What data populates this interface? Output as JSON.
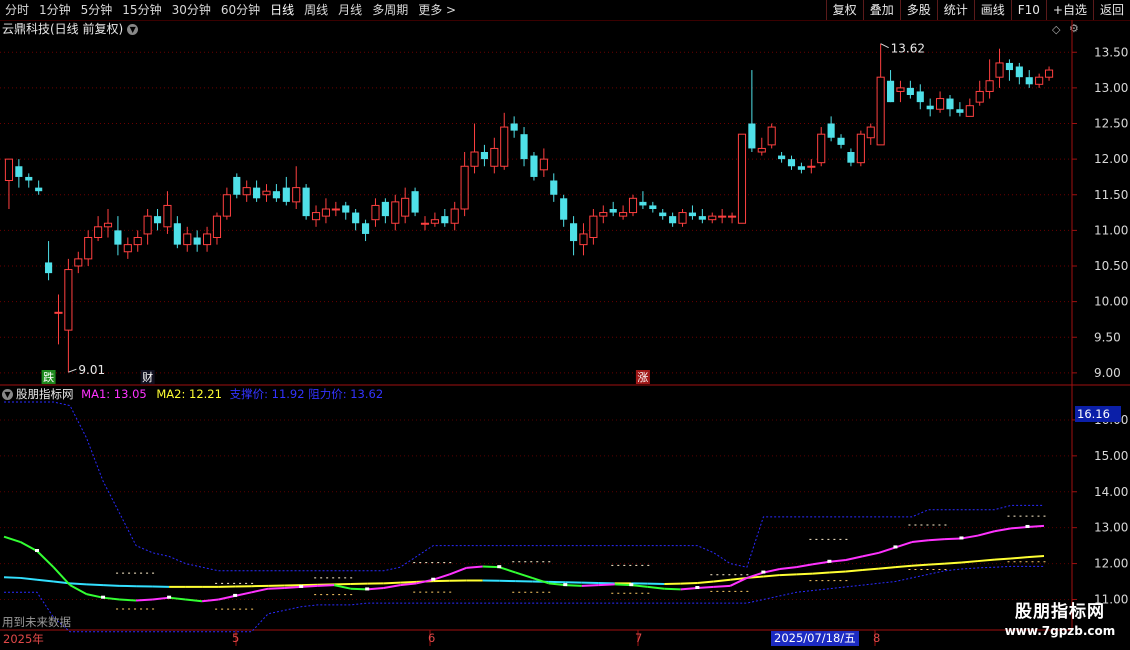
{
  "toolbar": {
    "timeframes": [
      "分时",
      "1分钟",
      "5分钟",
      "15分钟",
      "30分钟",
      "60分钟",
      "日线",
      "周线",
      "月线",
      "多周期",
      "更多 >"
    ],
    "active_index": 6,
    "tools": [
      "复权",
      "叠加",
      "多股",
      "统计",
      "画线",
      "F10",
      "+自选",
      "返回"
    ]
  },
  "stock_title": "云鼎科技(日线 前复权)",
  "price_axis": [
    "13.50",
    "13.00",
    "12.50",
    "12.00",
    "11.50",
    "11.00",
    "10.50",
    "10.00",
    "9.50",
    "9.00"
  ],
  "annotations": {
    "high": "13.62",
    "low": "9.01"
  },
  "markers": [
    {
      "text": "跌",
      "bg": "#1f8a1f",
      "fg": "#ffffff"
    },
    {
      "text": "财",
      "bg": "#101020",
      "fg": "#ffffff"
    },
    {
      "text": "涨",
      "bg": "#a01818",
      "fg": "#ffffff"
    }
  ],
  "indicator": {
    "name": "股朋指标网",
    "ma1_label": "MA1: 13.05",
    "ma2_label": "MA2: 12.21",
    "support_label": "支撑价: 11.92",
    "resistance_label": "阻力价: 13.62",
    "colors": {
      "ma1": "#ff33ff",
      "ma2": "#ffff33",
      "support": "#3333ff",
      "resistance": "#3333ff",
      "name": "#e8e8e8"
    },
    "axis": [
      "16.16",
      "16.00",
      "15.00",
      "14.00",
      "13.00",
      "12.00",
      "11.00"
    ],
    "current": "16.16"
  },
  "future_label": "用到未来数据",
  "x_labels": [
    "2025年",
    "5",
    "6",
    "7",
    "8"
  ],
  "date_box": "2025/07/18/五",
  "watermark": {
    "line1": "股朋指标网",
    "line2": "www.7gpzb.com"
  },
  "colors": {
    "up": "#ff4040",
    "down": "#4fe0e8",
    "grid": "#7a0000",
    "axis_text": "#d04040",
    "bg": "#000000"
  },
  "chart_data": [
    {
      "type": "candlestick",
      "title": "云鼎科技(日线 前复权)",
      "ylim": [
        8.9,
        13.7
      ],
      "candles": [
        [
          11.7,
          12.0,
          12.0,
          11.3
        ],
        [
          11.9,
          11.75,
          12.0,
          11.6
        ],
        [
          11.75,
          11.7,
          11.8,
          11.6
        ],
        [
          11.6,
          11.55,
          11.7,
          11.5
        ],
        [
          10.55,
          10.4,
          10.85,
          10.3
        ],
        [
          9.85,
          9.85,
          10.1,
          9.4
        ],
        [
          9.6,
          10.45,
          10.6,
          9.01
        ],
        [
          10.5,
          10.6,
          10.7,
          10.4
        ],
        [
          10.6,
          10.9,
          11.0,
          10.5
        ],
        [
          10.9,
          11.05,
          11.2,
          10.85
        ],
        [
          11.05,
          11.1,
          11.3,
          10.9
        ],
        [
          11.0,
          10.8,
          11.2,
          10.65
        ],
        [
          10.7,
          10.8,
          10.9,
          10.6
        ],
        [
          10.8,
          10.9,
          11.0,
          10.7
        ],
        [
          10.95,
          11.2,
          11.3,
          10.8
        ],
        [
          11.2,
          11.1,
          11.3,
          11.0
        ],
        [
          11.05,
          11.35,
          11.55,
          10.95
        ],
        [
          11.1,
          10.8,
          11.2,
          10.75
        ],
        [
          10.8,
          10.95,
          11.05,
          10.7
        ],
        [
          10.9,
          10.8,
          11.0,
          10.7
        ],
        [
          10.8,
          10.95,
          11.05,
          10.7
        ],
        [
          10.9,
          11.2,
          11.25,
          10.8
        ],
        [
          11.2,
          11.5,
          11.6,
          11.15
        ],
        [
          11.75,
          11.5,
          11.8,
          11.45
        ],
        [
          11.5,
          11.6,
          11.7,
          11.4
        ],
        [
          11.6,
          11.45,
          11.7,
          11.4
        ],
        [
          11.5,
          11.55,
          11.65,
          11.4
        ],
        [
          11.55,
          11.45,
          11.65,
          11.4
        ],
        [
          11.6,
          11.4,
          11.75,
          11.35
        ],
        [
          11.4,
          11.6,
          11.9,
          11.3
        ],
        [
          11.6,
          11.2,
          11.65,
          11.15
        ],
        [
          11.15,
          11.25,
          11.35,
          11.05
        ],
        [
          11.2,
          11.3,
          11.45,
          11.1
        ],
        [
          11.3,
          11.3,
          11.4,
          11.2
        ],
        [
          11.35,
          11.25,
          11.4,
          11.15
        ],
        [
          11.25,
          11.1,
          11.3,
          11.0
        ],
        [
          11.1,
          10.95,
          11.15,
          10.85
        ],
        [
          11.15,
          11.35,
          11.45,
          11.05
        ],
        [
          11.4,
          11.2,
          11.45,
          11.1
        ],
        [
          11.1,
          11.4,
          11.5,
          11.0
        ],
        [
          11.2,
          11.45,
          11.6,
          11.1
        ],
        [
          11.55,
          11.25,
          11.6,
          11.2
        ],
        [
          11.1,
          11.1,
          11.2,
          11.0
        ],
        [
          11.1,
          11.15,
          11.25,
          11.05
        ],
        [
          11.2,
          11.1,
          11.3,
          11.05
        ],
        [
          11.1,
          11.3,
          11.4,
          11.0
        ],
        [
          11.3,
          11.9,
          12.1,
          11.2
        ],
        [
          11.9,
          12.1,
          12.5,
          11.8
        ],
        [
          12.1,
          12.0,
          12.2,
          11.9
        ],
        [
          11.9,
          12.15,
          12.3,
          11.8
        ],
        [
          11.9,
          12.45,
          12.65,
          11.85
        ],
        [
          12.5,
          12.4,
          12.6,
          12.3
        ],
        [
          12.35,
          12.0,
          12.45,
          11.9
        ],
        [
          12.05,
          11.75,
          12.1,
          11.7
        ],
        [
          11.85,
          12.0,
          12.15,
          11.75
        ],
        [
          11.7,
          11.5,
          11.8,
          11.4
        ],
        [
          11.45,
          11.15,
          11.5,
          11.05
        ],
        [
          11.1,
          10.85,
          11.2,
          10.65
        ],
        [
          10.8,
          10.95,
          11.1,
          10.65
        ],
        [
          10.9,
          11.2,
          11.3,
          10.8
        ],
        [
          11.2,
          11.25,
          11.35,
          11.1
        ],
        [
          11.3,
          11.25,
          11.4,
          11.2
        ],
        [
          11.2,
          11.25,
          11.35,
          11.15
        ],
        [
          11.25,
          11.45,
          11.5,
          11.2
        ],
        [
          11.4,
          11.35,
          11.55,
          11.3
        ],
        [
          11.35,
          11.3,
          11.4,
          11.25
        ],
        [
          11.25,
          11.2,
          11.3,
          11.15
        ],
        [
          11.2,
          11.1,
          11.25,
          11.05
        ],
        [
          11.1,
          11.25,
          11.3,
          11.05
        ],
        [
          11.25,
          11.2,
          11.35,
          11.15
        ],
        [
          11.2,
          11.15,
          11.3,
          11.1
        ],
        [
          11.15,
          11.2,
          11.25,
          11.1
        ],
        [
          11.2,
          11.2,
          11.3,
          11.1
        ],
        [
          11.2,
          11.2,
          11.25,
          11.1
        ],
        [
          11.1,
          12.35,
          12.35,
          11.1
        ],
        [
          12.5,
          12.15,
          13.25,
          12.1
        ],
        [
          12.1,
          12.15,
          12.3,
          12.05
        ],
        [
          12.2,
          12.45,
          12.5,
          12.15
        ],
        [
          12.05,
          12.0,
          12.1,
          11.95
        ],
        [
          12.0,
          11.9,
          12.05,
          11.85
        ],
        [
          11.9,
          11.85,
          11.95,
          11.8
        ],
        [
          11.9,
          11.9,
          12.0,
          11.8
        ],
        [
          11.95,
          12.35,
          12.45,
          11.9
        ],
        [
          12.5,
          12.3,
          12.6,
          12.25
        ],
        [
          12.3,
          12.2,
          12.35,
          12.15
        ],
        [
          12.1,
          11.95,
          12.15,
          11.9
        ],
        [
          11.95,
          12.35,
          12.4,
          11.9
        ],
        [
          12.3,
          12.45,
          12.5,
          12.2
        ],
        [
          12.2,
          13.15,
          13.62,
          12.2
        ],
        [
          13.1,
          12.8,
          13.25,
          12.8
        ],
        [
          12.95,
          13.0,
          13.1,
          12.8
        ],
        [
          13.0,
          12.9,
          13.1,
          12.85
        ],
        [
          12.95,
          12.8,
          13.05,
          12.7
        ],
        [
          12.75,
          12.7,
          12.85,
          12.6
        ],
        [
          12.7,
          12.85,
          12.95,
          12.65
        ],
        [
          12.85,
          12.7,
          12.9,
          12.6
        ],
        [
          12.7,
          12.65,
          12.8,
          12.6
        ],
        [
          12.6,
          12.75,
          12.85,
          12.6
        ],
        [
          12.8,
          12.95,
          13.1,
          12.75
        ],
        [
          12.95,
          13.1,
          13.4,
          12.85
        ],
        [
          13.15,
          13.35,
          13.55,
          13.0
        ],
        [
          13.35,
          13.25,
          13.4,
          13.1
        ],
        [
          13.3,
          13.15,
          13.35,
          13.05
        ],
        [
          13.15,
          13.05,
          13.25,
          13.0
        ],
        [
          13.05,
          13.15,
          13.2,
          13.0
        ],
        [
          13.15,
          13.25,
          13.3,
          13.1
        ]
      ]
    },
    {
      "type": "line",
      "title": "股朋指标网",
      "ylim": [
        10.15,
        16.5
      ],
      "series": [
        {
          "name": "MA1",
          "values": [
            12.75,
            12.6,
            12.35,
            11.9,
            11.4,
            11.15,
            11.05,
            11.0,
            10.97,
            11.0,
            11.05,
            11.0,
            10.95,
            11.0,
            11.1,
            11.2,
            11.3,
            11.32,
            11.35,
            11.38,
            11.4,
            11.3,
            11.28,
            11.32,
            11.4,
            11.45,
            11.55,
            11.7,
            11.88,
            11.92,
            11.9,
            11.75,
            11.6,
            11.45,
            11.4,
            11.38,
            11.4,
            11.42,
            11.4,
            11.35,
            11.3,
            11.28,
            11.32,
            11.35,
            11.38,
            11.6,
            11.75,
            11.85,
            11.9,
            11.98,
            12.05,
            12.1,
            12.2,
            12.3,
            12.45,
            12.6,
            12.65,
            12.68,
            12.7,
            12.78,
            12.9,
            12.98,
            13.02,
            13.05
          ]
        },
        {
          "name": "MA2",
          "values": [
            11.62,
            11.6,
            11.55,
            11.5,
            11.45,
            11.42,
            11.4,
            11.38,
            11.37,
            11.36,
            11.35,
            11.35,
            11.35,
            11.35,
            11.36,
            11.37,
            11.38,
            11.39,
            11.4,
            11.41,
            11.42,
            11.43,
            11.44,
            11.45,
            11.47,
            11.49,
            11.51,
            11.52,
            11.53,
            11.53,
            11.52,
            11.51,
            11.5,
            11.49,
            11.48,
            11.47,
            11.46,
            11.45,
            11.45,
            11.44,
            11.43,
            11.44,
            11.46,
            11.5,
            11.55,
            11.6,
            11.64,
            11.68,
            11.7,
            11.72,
            11.75,
            11.78,
            11.82,
            11.86,
            11.9,
            11.94,
            11.97,
            12.0,
            12.03,
            12.07,
            12.11,
            12.14,
            12.18,
            12.21
          ]
        }
      ],
      "support": [
        11.2,
        11.2,
        11.2,
        10.5,
        10.1,
        10.1,
        10.1,
        10.1,
        10.1,
        10.1,
        10.1,
        10.1,
        10.1,
        10.1,
        10.1,
        10.1,
        10.6,
        10.7,
        10.8,
        10.85,
        10.85,
        10.85,
        10.9,
        10.9,
        10.9,
        10.9,
        10.9,
        10.9,
        10.9,
        10.9,
        10.9,
        10.9,
        10.9,
        10.9,
        10.9,
        10.9,
        10.9,
        10.9,
        10.9,
        10.9,
        10.9,
        10.9,
        10.9,
        10.9,
        10.9,
        10.9,
        11.0,
        11.1,
        11.2,
        11.25,
        11.3,
        11.35,
        11.4,
        11.45,
        11.5,
        11.6,
        11.7,
        11.8,
        11.85,
        11.88,
        11.9,
        11.92,
        11.92,
        11.92
      ],
      "resistance": [
        16.5,
        16.5,
        16.5,
        16.5,
        16.4,
        15.5,
        14.3,
        13.4,
        12.5,
        12.3,
        12.2,
        12.0,
        11.9,
        11.8,
        11.8,
        11.8,
        11.8,
        11.8,
        11.8,
        11.8,
        11.8,
        11.8,
        11.8,
        11.8,
        11.9,
        12.2,
        12.5,
        12.5,
        12.5,
        12.5,
        12.5,
        12.5,
        12.5,
        12.5,
        12.5,
        12.5,
        12.5,
        12.5,
        12.5,
        12.5,
        12.5,
        12.5,
        12.5,
        12.3,
        12.0,
        11.9,
        13.3,
        13.3,
        13.3,
        13.3,
        13.3,
        13.3,
        13.3,
        13.3,
        13.3,
        13.3,
        13.5,
        13.5,
        13.5,
        13.5,
        13.5,
        13.62,
        13.62,
        13.62
      ]
    }
  ]
}
